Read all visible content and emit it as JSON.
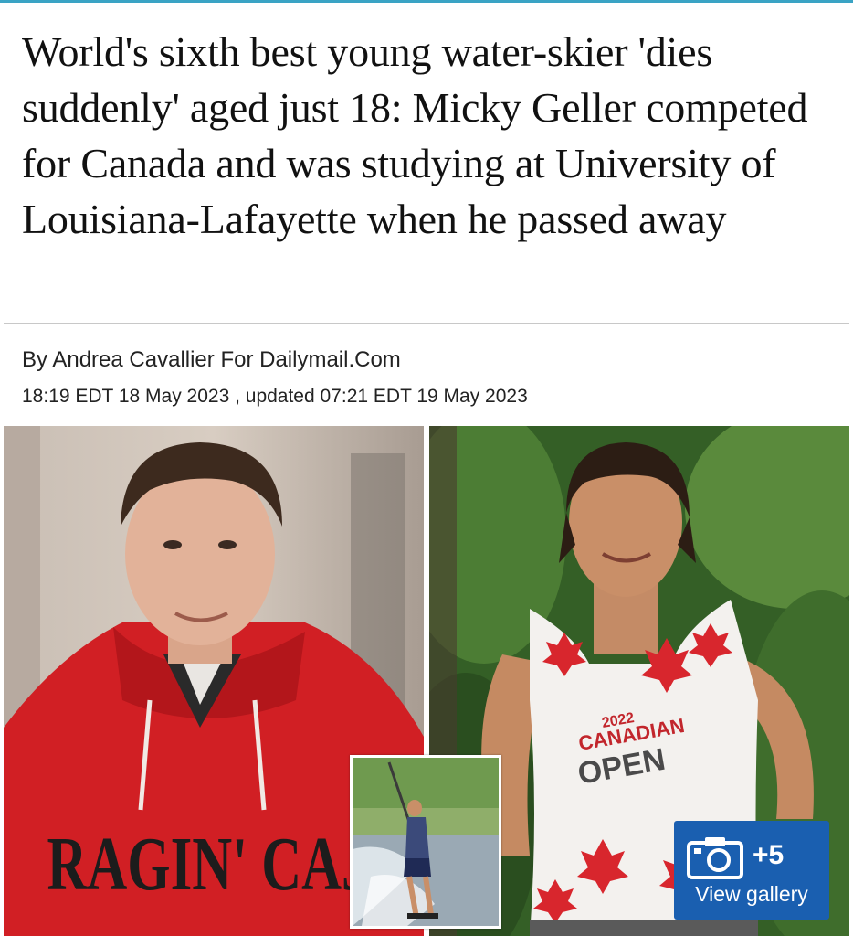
{
  "article": {
    "headline": "World's sixth best young water-skier 'dies suddenly' aged just 18: Micky Geller competed for Canada and was studying at University of Louisiana-Lafayette when he passed away",
    "byline": "By Andrea Cavallier For Dailymail.Com",
    "dateline": "18:19 EDT 18 May 2023 , updated 07:21 EDT 19 May 2023"
  },
  "photos": {
    "left_hoodie_text": "RAGIN' CAJUNS",
    "tank_year": "2022",
    "tank_line1": "CANADIAN",
    "tank_line2": "OPEN"
  },
  "gallery": {
    "count": "+5",
    "label": "View gallery",
    "icon": "camera-icon"
  },
  "colors": {
    "accent_rule": "#3aa3c4",
    "gallery_button": "#1a5fb0"
  }
}
